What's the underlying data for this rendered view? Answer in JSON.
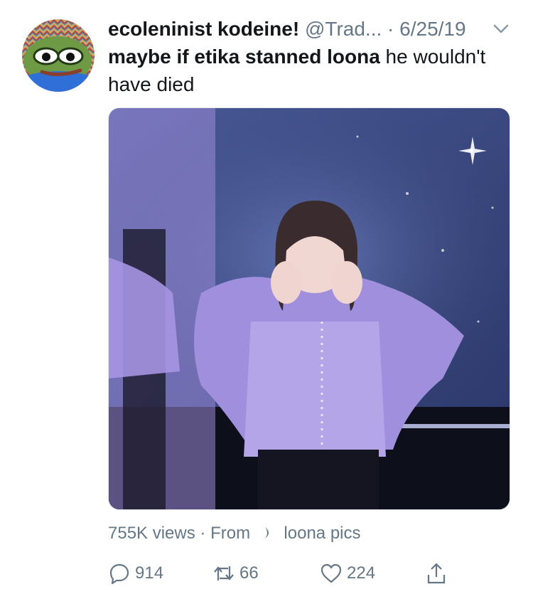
{
  "tweet": {
    "author_name": "ecoleninist kodeine!",
    "author_handle": "@Trad...",
    "separator": "·",
    "date": "6/25/19",
    "text_bold": "maybe if etika stanned loona",
    "text_rest": " he wouldn't have died",
    "media_kind": "video"
  },
  "meta": {
    "views": "755K views",
    "separator": "·",
    "from_label": "From",
    "source": "loona pics"
  },
  "actions": {
    "reply_count": "914",
    "retweet_count": "66",
    "like_count": "224"
  },
  "icons": {
    "reply": "reply-icon",
    "retweet": "retweet-icon",
    "like": "heart-icon",
    "share": "share-icon",
    "more": "chevron-down-icon"
  },
  "colors": {
    "text": "#14171a",
    "secondary": "#657786",
    "media_tint": "#9a86d6"
  }
}
